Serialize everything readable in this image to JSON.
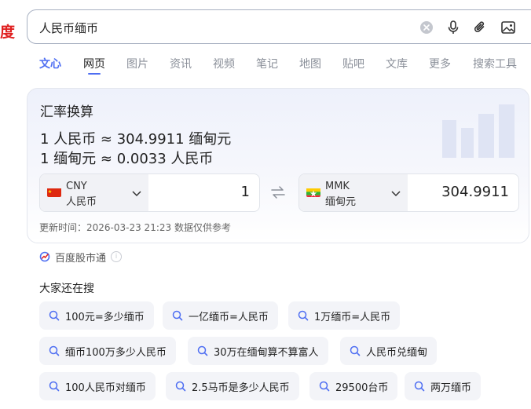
{
  "brand": {
    "logo_fragment": "度"
  },
  "search": {
    "query": "人民币缅币"
  },
  "tabs": [
    {
      "label": "文心"
    },
    {
      "label": "网页"
    },
    {
      "label": "图片"
    },
    {
      "label": "资讯"
    },
    {
      "label": "视频"
    },
    {
      "label": "笔记"
    },
    {
      "label": "地图"
    },
    {
      "label": "贴吧"
    },
    {
      "label": "文库"
    },
    {
      "label": "更多"
    },
    {
      "label": "搜索工具"
    }
  ],
  "converter": {
    "title": "汇率换算",
    "rate_forward": "1 人民币 ≈ 304.9911 缅甸元",
    "rate_reverse": "1 缅甸元 ≈ 0.0033 人民币",
    "from": {
      "code": "CNY",
      "name": "人民币",
      "amount": "1"
    },
    "to": {
      "code": "MMK",
      "name": "缅甸元",
      "amount": "304.9911"
    },
    "update_text": "更新时间：2026-03-23 21:23 数据仅供参考",
    "colors": {
      "cny_flag": "#de2910",
      "mmk_flag_yellow": "#fecb00",
      "mmk_flag_green": "#34b233",
      "mmk_flag_red": "#ea2839"
    }
  },
  "source": {
    "label": "百度股市通"
  },
  "related": {
    "title": "大家还在搜",
    "chips": [
      "100元=多少缅币",
      "一亿缅币=人民币",
      "1万缅币=人民币",
      "缅币100万多少人民币",
      "30万在缅甸算不算富人",
      "人民币兑缅甸",
      "100人民币对缅币",
      "2.5马币是多少人民币",
      "29500台币",
      "两万缅币"
    ]
  },
  "colors": {
    "accent": "#4e6ef2",
    "brand_red": "#e02020"
  }
}
